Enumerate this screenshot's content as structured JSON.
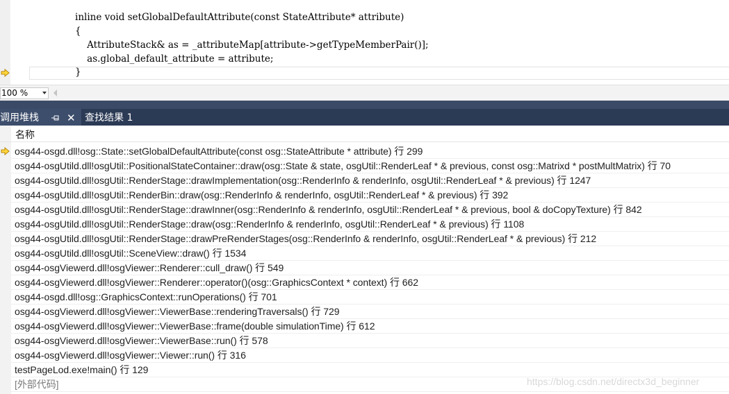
{
  "editor": {
    "lines": [
      "inline void setGlobalDefaultAttribute(const StateAttribute* attribute)",
      "{",
      "    AttributeStack& as = _attributeMap[attribute->getTypeMemberPair()];",
      "    as.global_default_attribute = attribute;",
      "}"
    ]
  },
  "zoom": {
    "value": "100 %"
  },
  "toolwindow": {
    "tabs": [
      {
        "label": "调用堆栈",
        "active": true
      },
      {
        "label": "查找结果 1",
        "active": false
      }
    ],
    "pin_icon": "pin-icon",
    "close_icon": "close-icon"
  },
  "callstack": {
    "column_header": "名称",
    "rows": [
      "osg44-osgd.dll!osg::State::setGlobalDefaultAttribute(const osg::StateAttribute * attribute) 行 299",
      "osg44-osgUtild.dll!osgUtil::PositionalStateContainer::draw(osg::State & state, osgUtil::RenderLeaf * & previous, const osg::Matrixd * postMultMatrix) 行 70",
      "osg44-osgUtild.dll!osgUtil::RenderStage::drawImplementation(osg::RenderInfo & renderInfo, osgUtil::RenderLeaf * & previous) 行 1247",
      "osg44-osgUtild.dll!osgUtil::RenderBin::draw(osg::RenderInfo & renderInfo, osgUtil::RenderLeaf * & previous) 行 392",
      "osg44-osgUtild.dll!osgUtil::RenderStage::drawInner(osg::RenderInfo & renderInfo, osgUtil::RenderLeaf * & previous, bool & doCopyTexture) 行 842",
      "osg44-osgUtild.dll!osgUtil::RenderStage::draw(osg::RenderInfo & renderInfo, osgUtil::RenderLeaf * & previous) 行 1108",
      "osg44-osgUtild.dll!osgUtil::RenderStage::drawPreRenderStages(osg::RenderInfo & renderInfo, osgUtil::RenderLeaf * & previous) 行 212",
      "osg44-osgUtild.dll!osgUtil::SceneView::draw() 行 1534",
      "osg44-osgViewerd.dll!osgViewer::Renderer::cull_draw() 行 549",
      "osg44-osgViewerd.dll!osgViewer::Renderer::operator()(osg::GraphicsContext * context) 行 662",
      "osg44-osgd.dll!osg::GraphicsContext::runOperations() 行 701",
      "osg44-osgViewerd.dll!osgViewer::ViewerBase::renderingTraversals() 行 729",
      "osg44-osgViewerd.dll!osgViewer::ViewerBase::frame(double simulationTime) 行 612",
      "osg44-osgViewerd.dll!osgViewer::ViewerBase::run() 行 578",
      "osg44-osgViewerd.dll!osgViewer::Viewer::run() 行 316",
      "testPageLod.exe!main() 行 129",
      "[外部代码]"
    ]
  },
  "watermark": "https://blog.csdn.net/directx3d_beginner",
  "colors": {
    "tool_header": "#2b3a55",
    "arrow_fill": "#ffd83c",
    "arrow_stroke": "#b8860b"
  }
}
